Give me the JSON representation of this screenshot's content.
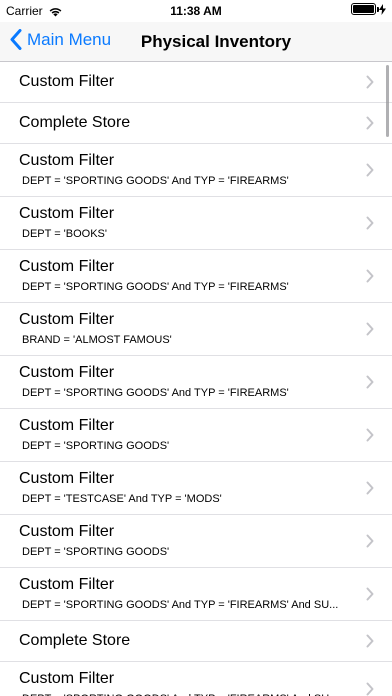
{
  "status_bar": {
    "carrier": "Carrier",
    "time": "11:38 AM"
  },
  "nav": {
    "back_label": "Main Menu",
    "title": "Physical Inventory"
  },
  "accent_color": "#0a7aff",
  "rows": [
    {
      "title": "Custom Filter",
      "subtitle": ""
    },
    {
      "title": "Complete Store",
      "subtitle": ""
    },
    {
      "title": "Custom Filter",
      "subtitle": "DEPT = 'SPORTING GOODS' And TYP = 'FIREARMS'"
    },
    {
      "title": "Custom Filter",
      "subtitle": "DEPT = 'BOOKS'"
    },
    {
      "title": "Custom Filter",
      "subtitle": "DEPT = 'SPORTING GOODS' And TYP = 'FIREARMS'"
    },
    {
      "title": "Custom Filter",
      "subtitle": "BRAND = 'ALMOST FAMOUS'"
    },
    {
      "title": "Custom Filter",
      "subtitle": "DEPT = 'SPORTING GOODS' And TYP = 'FIREARMS'"
    },
    {
      "title": "Custom Filter",
      "subtitle": "DEPT = 'SPORTING GOODS'"
    },
    {
      "title": "Custom Filter",
      "subtitle": "DEPT = 'TESTCASE' And TYP = 'MODS'"
    },
    {
      "title": "Custom Filter",
      "subtitle": "DEPT = 'SPORTING GOODS'"
    },
    {
      "title": "Custom Filter",
      "subtitle": "DEPT = 'SPORTING GOODS' And TYP = 'FIREARMS' And SU..."
    },
    {
      "title": "Complete Store",
      "subtitle": ""
    },
    {
      "title": "Custom Filter",
      "subtitle": "DEPT = 'SPORTING GOODS' And TYP = 'FIREARMS' And SU..."
    }
  ]
}
